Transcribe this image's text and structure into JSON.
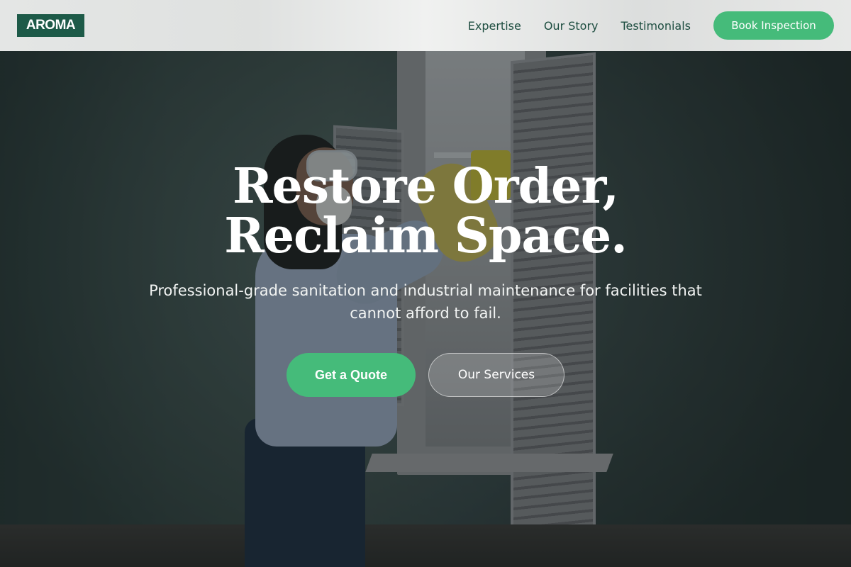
{
  "brand": {
    "logo_text": "AROMA"
  },
  "nav": {
    "links": [
      {
        "label": "Expertise"
      },
      {
        "label": "Our Story"
      },
      {
        "label": "Testimonials"
      }
    ],
    "cta_label": "Book Inspection"
  },
  "hero": {
    "title": "Restore Order, Reclaim Space.",
    "subtitle": "Professional-grade sanitation and industrial maintenance for facilities that cannot afford to fail.",
    "primary_button": "Get a Quote",
    "secondary_button": "Our Services",
    "background_image": "person-cleaning-window-photo"
  },
  "colors": {
    "brand_dark_green": "#1d5a48",
    "accent_green": "#45bb7a",
    "nav_text": "#1d4d40"
  }
}
